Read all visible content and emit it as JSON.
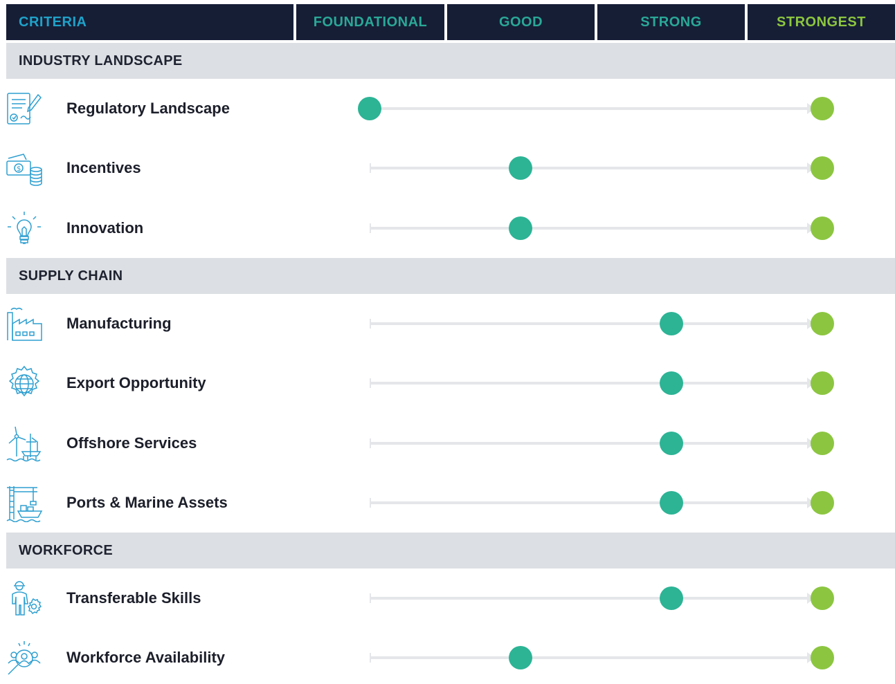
{
  "colors": {
    "header_bg": "#161e36",
    "criteria_text": "#1fa2c9",
    "teal_text": "#2aa897",
    "strongest_text": "#8cc63f",
    "section_bg": "#dcdfe3",
    "current_dot": "#2cb495",
    "target_dot": "#8cc641",
    "track": "#e4e6e9",
    "icon_stroke": "#2e9fd0"
  },
  "header": {
    "criteria": "CRITERIA",
    "levels": [
      "FOUNDATIONAL",
      "GOOD",
      "STRONG",
      "STRONGEST"
    ]
  },
  "sections": [
    {
      "title": "INDUSTRY LANDSCAPE",
      "rows": [
        {
          "label": "Regulatory Landscape",
          "icon": "document-pen-icon"
        },
        {
          "label": "Incentives",
          "icon": "money-coins-icon"
        },
        {
          "label": "Innovation",
          "icon": "lightbulb-icon"
        }
      ]
    },
    {
      "title": "SUPPLY CHAIN",
      "rows": [
        {
          "label": "Manufacturing",
          "icon": "factory-icon"
        },
        {
          "label": "Export Opportunity",
          "icon": "globe-gear-icon"
        },
        {
          "label": "Offshore Services",
          "icon": "wind-turbine-icon"
        },
        {
          "label": "Ports & Marine Assets",
          "icon": "port-crane-ship-icon"
        }
      ]
    },
    {
      "title": "WORKFORCE",
      "rows": [
        {
          "label": "Transferable Skills",
          "icon": "worker-gear-icon"
        },
        {
          "label": "Workforce Availability",
          "icon": "person-search-icon"
        }
      ]
    }
  ],
  "chart_data": {
    "type": "table",
    "levels": [
      "FOUNDATIONAL",
      "GOOD",
      "STRONG",
      "STRONGEST"
    ],
    "series": [
      {
        "values": [
          "FOUNDATIONAL",
          "GOOD",
          "GOOD",
          "STRONG",
          "STRONG",
          "STRONG",
          "STRONG",
          "STRONG",
          "GOOD"
        ]
      },
      {
        "values": [
          "STRONGEST",
          "STRONGEST",
          "STRONGEST",
          "STRONGEST",
          "STRONGEST",
          "STRONGEST",
          "STRONGEST",
          "STRONGEST",
          "STRONGEST"
        ]
      }
    ],
    "categories": [
      "Regulatory Landscape",
      "Incentives",
      "Innovation",
      "Manufacturing",
      "Export Opportunity",
      "Offshore Services",
      "Ports & Marine Assets",
      "Transferable Skills",
      "Workforce Availability"
    ]
  }
}
